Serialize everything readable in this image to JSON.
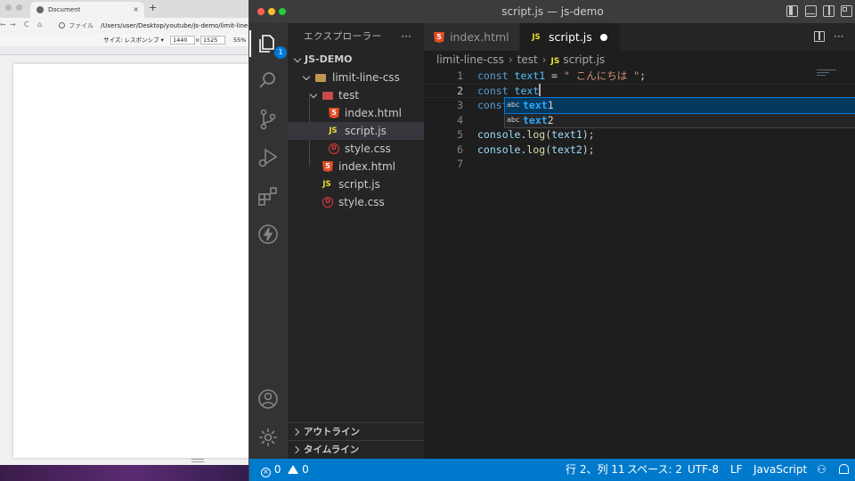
{
  "browser": {
    "tab_title": "Document",
    "tab_close": "×",
    "new_tab": "+",
    "nav_back": "←",
    "nav_forward": "→",
    "nav_reload": "C",
    "nav_home": "⌂",
    "url_scheme_label": "ファイル",
    "url": "/Users/user/Desktop/youtube/js-demo/limit-line-css/test/index.html",
    "device_toolbar": {
      "size_label": "サイズ: レスポンシブ ▾",
      "width": "1440",
      "times": "×",
      "height": "1525",
      "zoom": "55% ▾"
    }
  },
  "window": {
    "title": "script.js — js-demo"
  },
  "activity_bar": {
    "explorer_badge": "1"
  },
  "explorer": {
    "header": "エクスプローラー",
    "more": "···",
    "root": "JS-DEMO",
    "items": [
      {
        "label": "limit-line-css",
        "icon": "folder-icon"
      },
      {
        "label": "test",
        "icon": "folder-icon"
      },
      {
        "label": "index.html",
        "icon": "html-file-icon",
        "icon_text": "5"
      },
      {
        "label": "script.js",
        "icon": "js-file-icon",
        "icon_text": "JS"
      },
      {
        "label": "style.css",
        "icon": "css-file-icon",
        "icon_text": "D"
      },
      {
        "label": "index.html",
        "icon": "html-file-icon",
        "icon_text": "5"
      },
      {
        "label": "script.js",
        "icon": "js-file-icon",
        "icon_text": "JS"
      },
      {
        "label": "style.css",
        "icon": "css-file-icon",
        "icon_text": "D"
      }
    ],
    "outline_label": "アウトライン",
    "timeline_label": "タイムライン"
  },
  "tabs": [
    {
      "label": "index.html",
      "icon_text": "5",
      "active": false
    },
    {
      "label": "script.js",
      "icon_text": "JS",
      "active": true,
      "dirty": true
    }
  ],
  "tab_actions": {
    "more": "···"
  },
  "breadcrumbs": [
    "limit-line-css",
    "test",
    "script.js"
  ],
  "breadcrumb_js_icon": "JS",
  "editor": {
    "line_numbers": [
      "1",
      "2",
      "3",
      "4",
      "5",
      "6",
      "7"
    ],
    "lines": [
      [
        {
          "t": "const ",
          "c": "kw"
        },
        {
          "t": "text1",
          "c": "var"
        },
        {
          "t": " = ",
          "c": ""
        },
        {
          "t": "\" こんにちは \"",
          "c": "str"
        },
        {
          "t": ";",
          "c": ""
        }
      ],
      [
        {
          "t": "const ",
          "c": "kw"
        },
        {
          "t": "text",
          "c": "var"
        }
      ],
      [
        {
          "t": "const",
          "c": "kw"
        }
      ],
      [],
      [
        {
          "t": "console",
          "c": "obj"
        },
        {
          "t": ".",
          "c": ""
        },
        {
          "t": "log",
          "c": "fn"
        },
        {
          "t": "(",
          "c": ""
        },
        {
          "t": "text1",
          "c": "obj"
        },
        {
          "t": ");",
          "c": ""
        }
      ],
      [
        {
          "t": "console",
          "c": "obj"
        },
        {
          "t": ".",
          "c": ""
        },
        {
          "t": "log",
          "c": "fn"
        },
        {
          "t": "(",
          "c": ""
        },
        {
          "t": "text2",
          "c": "obj"
        },
        {
          "t": ");",
          "c": ""
        }
      ],
      []
    ],
    "current_line": 2
  },
  "suggestions": [
    {
      "kind": "abc",
      "match": "text",
      "rest": "1",
      "focused": true
    },
    {
      "kind": "abc",
      "match": "text",
      "rest": "2",
      "focused": false
    }
  ],
  "status_bar": {
    "errors": "0",
    "warnings": "0",
    "cursor_position": "行 2、列 11",
    "indentation": "スペース: 2",
    "encoding": "UTF-8",
    "eol": "LF",
    "language": "JavaScript"
  },
  "colors": {
    "status_bar": "#007acc",
    "editor_bg": "#1e1e1e",
    "sidebar_bg": "#252526",
    "activity_bar_bg": "#333333",
    "keyword": "#569cd6",
    "variable": "#4fc1ff",
    "string": "#ce9178",
    "function": "#dcdcaa"
  }
}
